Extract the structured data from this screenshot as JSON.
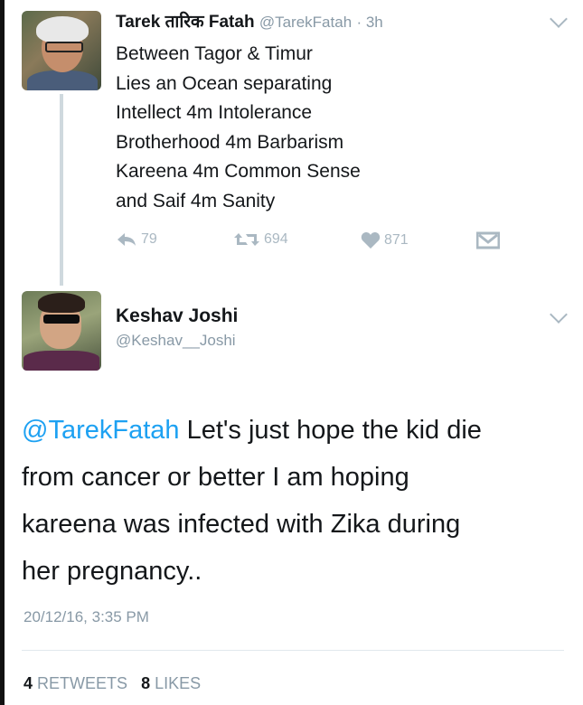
{
  "tweet1": {
    "display_name": "Tarek तारिक Fatah",
    "handle": "@TarekFatah",
    "time": "· 3h",
    "lines": [
      "Between Tagor & Timur",
      "Lies an Ocean separating",
      "Intellect 4m Intolerance",
      "Brotherhood 4m Barbarism",
      "Kareena 4m Common Sense",
      "and Saif 4m Sanity"
    ],
    "replies": "79",
    "retweets": "694",
    "likes": "871",
    "icons": [
      "reply-icon",
      "retweet-icon",
      "heart-icon",
      "direct-message-icon",
      "chevron-down-icon"
    ]
  },
  "tweet2": {
    "display_name": "Keshav Joshi",
    "handle": "@Keshav__Joshi",
    "mention": "@TarekFatah",
    "lines": [
      " Let's just hope the kid die",
      "from cancer or better I am hoping",
      "kareena was infected with Zika during",
      "her pregnancy.."
    ],
    "timestamp": "20/12/16, 3:35 PM",
    "retweet_count": "4",
    "retweet_label": "RETWEETS",
    "like_count": "8",
    "like_label": "LIKES"
  },
  "colors": {
    "link": "#1da1f2",
    "muted": "#8899a6",
    "text": "#14171a"
  }
}
